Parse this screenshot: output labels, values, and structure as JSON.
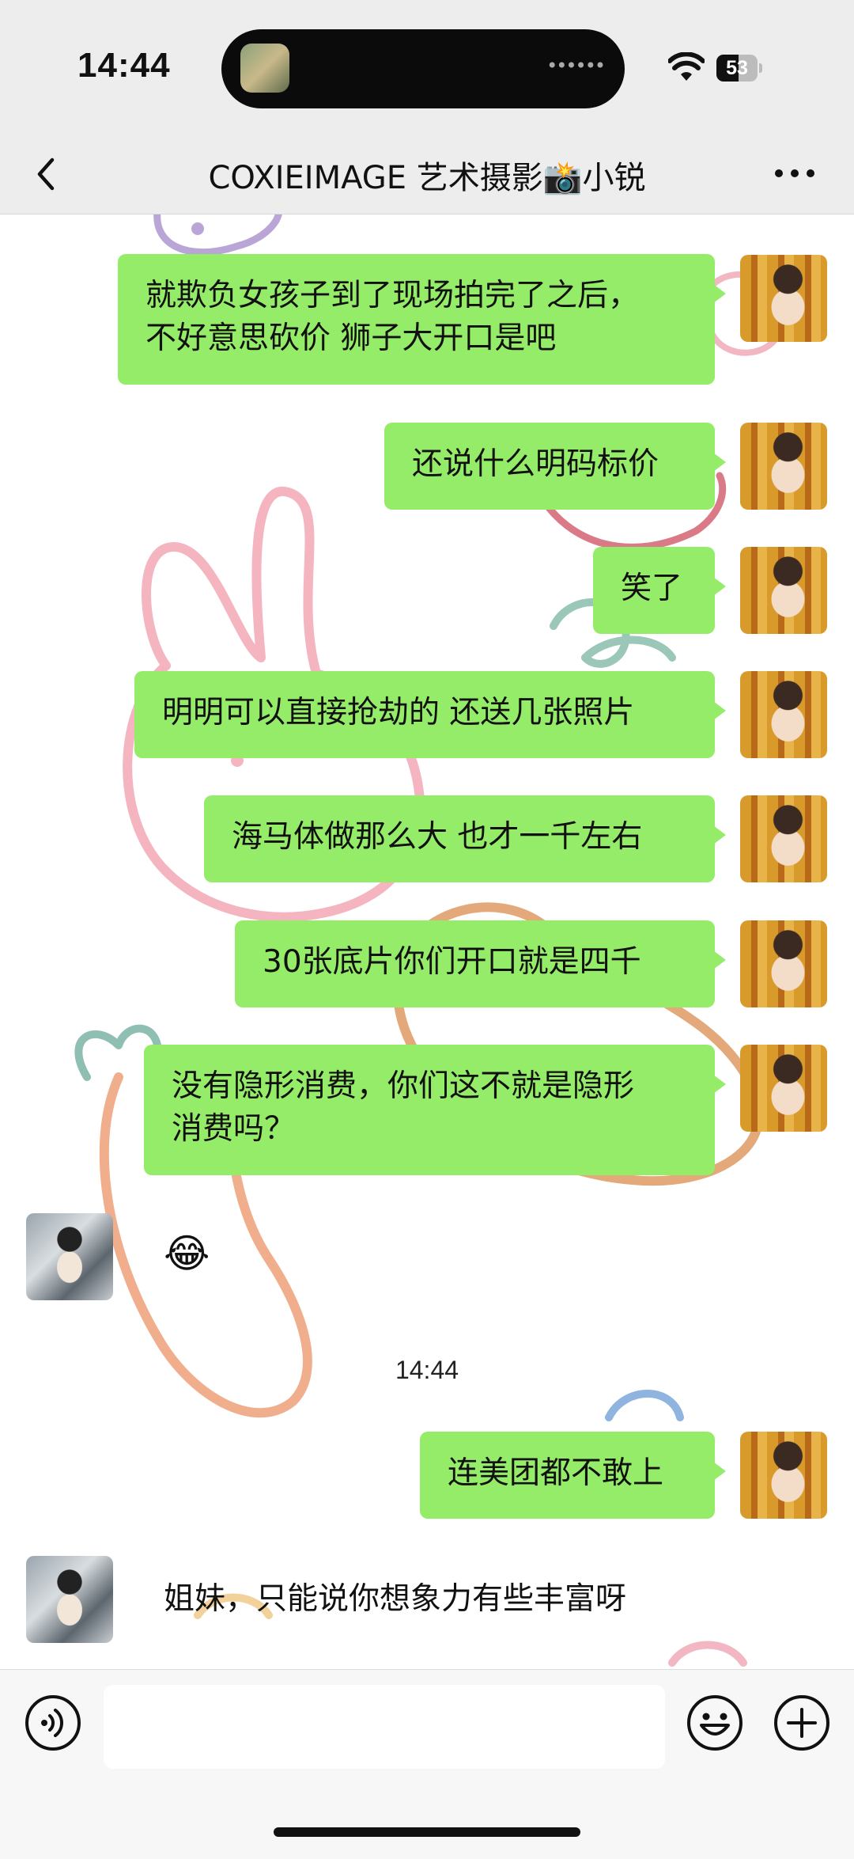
{
  "status_bar": {
    "time": "14:44",
    "battery": "53",
    "battery_level": 0.53
  },
  "nav": {
    "title": "COXIEIMAGE 艺术摄影📸小锐"
  },
  "messages": [
    {
      "side": "me",
      "text_lines": [
        "就欺负女孩子到了现场拍完了之后，",
        "不好意思砍价 狮子大开口是吧"
      ]
    },
    {
      "side": "me",
      "text": "还说什么明码标价"
    },
    {
      "side": "me",
      "text": "笑了"
    },
    {
      "side": "me",
      "text": "明明可以直接抢劫的 还送几张照片"
    },
    {
      "side": "me",
      "text": "海马体做那么大 也才一千左右"
    },
    {
      "side": "me",
      "text": "30张底片你们开口就是四千"
    },
    {
      "side": "me",
      "text_lines": [
        "没有隐形消费，你们这不就是隐形",
        "消费吗？"
      ]
    },
    {
      "side": "other",
      "text": "😂"
    },
    {
      "type": "timestamp",
      "text": "14:44"
    },
    {
      "side": "me",
      "text": "连美团都不敢上"
    },
    {
      "side": "other",
      "text": "姐妹，只能说你想象力有些丰富呀"
    }
  ],
  "input_bar": {
    "placeholder": ""
  },
  "icons": {
    "back": "chevron-left-icon",
    "more": "ellipsis-icon",
    "voice": "voice-icon",
    "emoji": "smiley-icon",
    "plus": "plus-icon"
  },
  "colors": {
    "bubble_me": "#95ec69",
    "chat_bg": "#ffffff",
    "bar_bg": "#ededed"
  }
}
